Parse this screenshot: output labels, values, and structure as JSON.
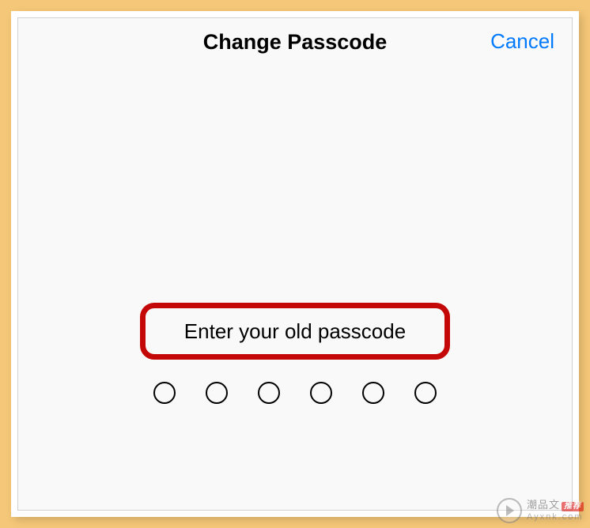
{
  "header": {
    "title": "Change Passcode",
    "cancel_label": "Cancel"
  },
  "prompt": {
    "text": "Enter your old passcode"
  },
  "passcode": {
    "digit_count": 6
  },
  "watermark": {
    "brand_cn": "潮品文",
    "brand_tag": "推荐",
    "domain": "Ayxnk.com"
  }
}
